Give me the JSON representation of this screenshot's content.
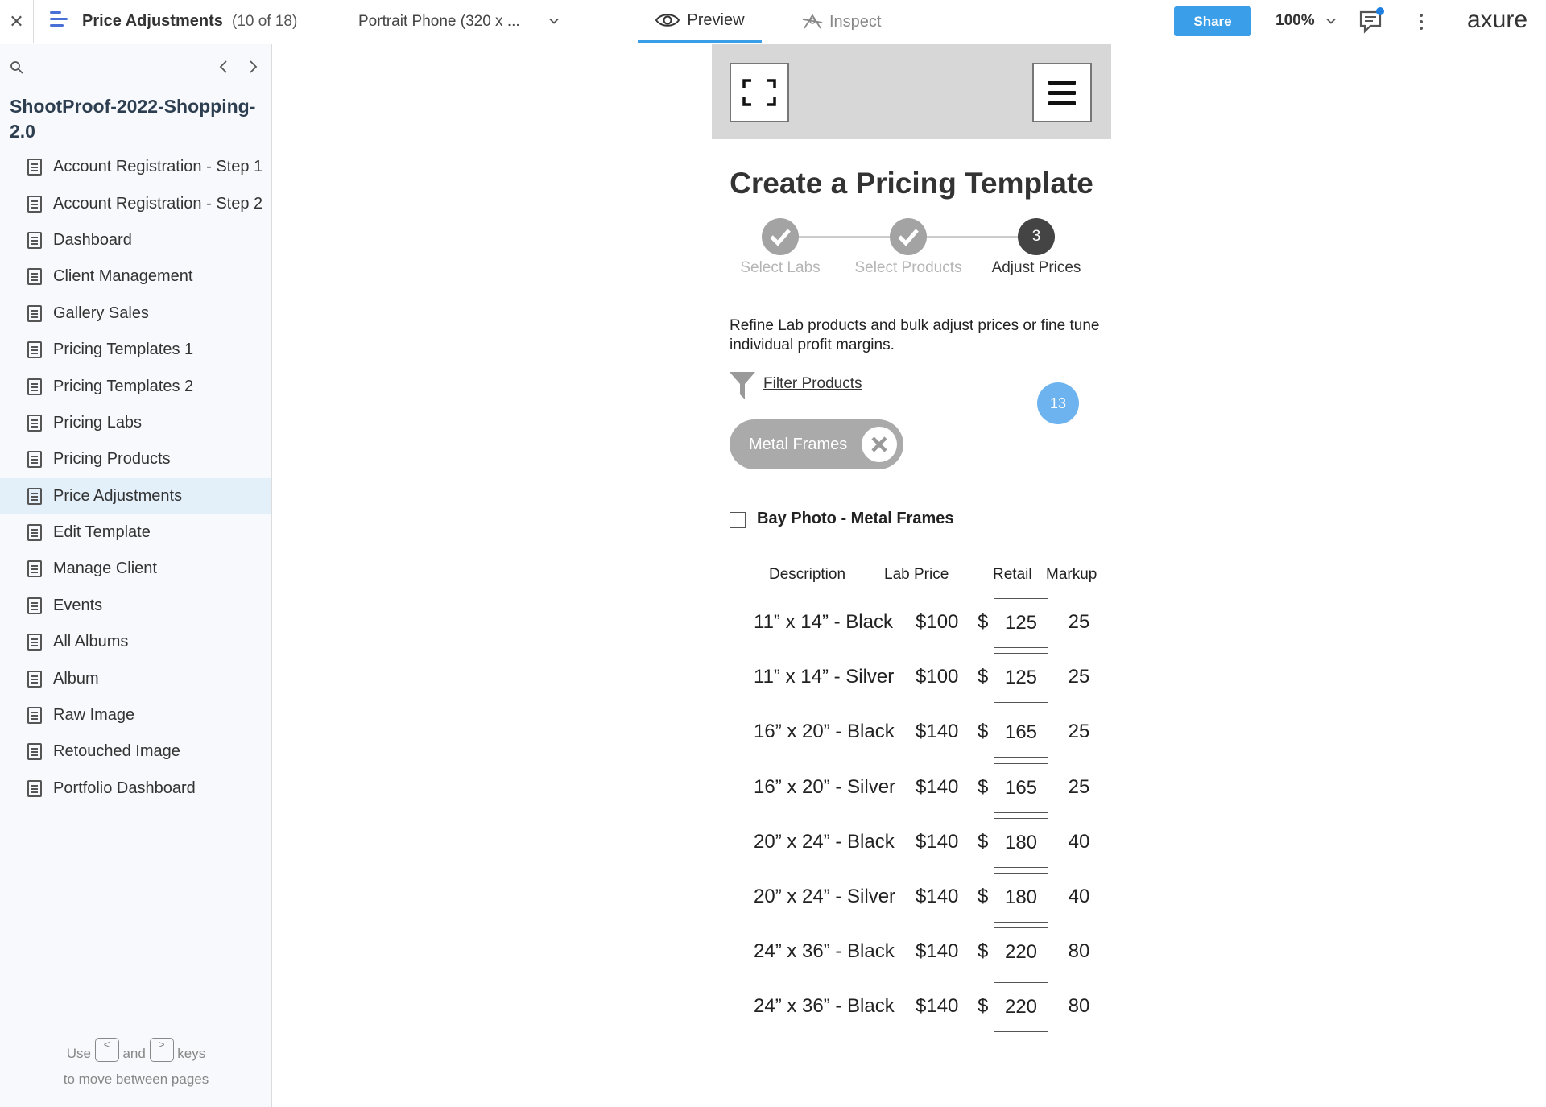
{
  "topbar": {
    "close_glyph": "✕",
    "page_title": "Price Adjustments",
    "page_count": "(10 of 18)",
    "device": "Portrait Phone (320 x ...",
    "tab_preview": "Preview",
    "tab_inspect": "Inspect",
    "share_label": "Share",
    "zoom": "100%",
    "logo": "axure",
    "accent_color": "#3b9ee8"
  },
  "sidebar": {
    "project_title": "ShootProof-2022-Shopping-2.0",
    "pages": [
      "Account Registration - Step 1",
      "Account Registration - Step 2",
      "Dashboard",
      "Client Management",
      "Gallery Sales",
      "Pricing Templates 1",
      "Pricing Templates 2",
      "Pricing Labs",
      "Pricing Products",
      "Price Adjustments",
      "Edit Template",
      "Manage Client",
      "Events",
      "All Albums",
      "Album",
      "Raw Image",
      "Retouched Image",
      "Portfolio Dashboard"
    ],
    "active_page": "Price Adjustments",
    "hint": {
      "use": "Use",
      "key_prev": "<",
      "and": "and",
      "key_next": ">",
      "keys": "keys",
      "line2": "to move between pages"
    }
  },
  "prototype": {
    "title": "Create a Pricing Template",
    "steps": [
      {
        "label": "Select Labs",
        "state": "done"
      },
      {
        "label": "Select Products",
        "state": "done"
      },
      {
        "label": "Adjust Prices",
        "state": "current",
        "number": "3"
      }
    ],
    "description": "Refine Lab products and bulk adjust prices or fine tune individual profit margins.",
    "filter_label": "Filter Products",
    "badge_count": "13",
    "chip_label": "Metal Frames",
    "group_label": "Bay Photo - Metal Frames",
    "table": {
      "headers": [
        "Description",
        "Lab Price",
        "Retail",
        "Markup"
      ],
      "currency": "$",
      "rows": [
        {
          "description": "11” x 14” - Black",
          "lab_price": "$100",
          "retail": "125",
          "markup": "25"
        },
        {
          "description": "11” x 14” - Silver",
          "lab_price": "$100",
          "retail": "125",
          "markup": "25"
        },
        {
          "description": "16” x 20” - Black",
          "lab_price": "$140",
          "retail": "165",
          "markup": "25"
        },
        {
          "description": "16” x 20” - Silver",
          "lab_price": "$140",
          "retail": "165",
          "markup": "25"
        },
        {
          "description": "20” x 24” - Black",
          "lab_price": "$140",
          "retail": "180",
          "markup": "40"
        },
        {
          "description": "20” x 24” - Silver",
          "lab_price": "$140",
          "retail": "180",
          "markup": "40"
        },
        {
          "description": "24” x 36” - Black",
          "lab_price": "$140",
          "retail": "220",
          "markup": "80"
        },
        {
          "description": "24” x 36” - Black",
          "lab_price": "$140",
          "retail": "220",
          "markup": "80"
        }
      ]
    }
  }
}
